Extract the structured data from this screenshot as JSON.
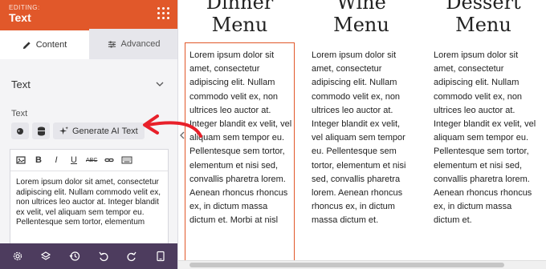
{
  "panel": {
    "editing_label": "EDITING:",
    "title": "Text",
    "tabs": {
      "content": "Content",
      "advanced": "Advanced"
    },
    "section_title": "Text",
    "field_label": "Text",
    "ai_button": "Generate AI Text",
    "editor_text": "Lorem ipsum dolor sit amet, consectetur adipiscing elit. Nullam commodo velit ex, non ultrices leo auctor at. Integer blandit ex velit, vel aliquam sem tempor eu. Pellentesque sem tortor, elementum",
    "toolbar": {
      "bold": "B",
      "italic": "I",
      "underline": "U",
      "strike": "ABC"
    }
  },
  "preview": {
    "columns": [
      {
        "title": "Dinner\nMenu",
        "body": "Lorem ipsum dolor sit amet, consectetur adipiscing elit. Nullam commodo velit ex, non ultrices leo auctor at. Integer blandit ex velit, vel aliquam sem tempor eu. Pellentesque sem tortor, elementum et nisi sed, convallis pharetra lorem. Aenean rhoncus rhoncus ex, in dictum massa dictum et. Morbi at nisl"
      },
      {
        "title": "Wine\nMenu",
        "body": "Lorem ipsum dolor sit amet, consectetur adipiscing elit. Nullam commodo velit ex, non ultrices leo auctor at. Integer blandit ex velit, vel aliquam sem tempor eu. Pellentesque sem tortor, elementum et nisi sed, convallis pharetra lorem. Aenean rhoncus rhoncus ex, in dictum massa dictum et."
      },
      {
        "title": "Dessert\nMenu",
        "body": "Lorem ipsum dolor sit amet, consectetur adipiscing elit. Nullam commodo velit ex, non ultrices leo auctor at. Integer blandit ex velit, vel aliquam sem tempor eu. Pellentesque sem tortor, elementum et nisi sed, convallis pharetra lorem. Aenean rhoncus rhoncus ex, in dictum massa dictum et."
      }
    ]
  },
  "icons": {
    "header": "grid-icon",
    "bottom": [
      "gear-icon",
      "layers-icon",
      "history-icon",
      "undo-icon",
      "redo-icon",
      "device-preview-icon"
    ]
  },
  "colors": {
    "accent": "#e1582a",
    "bottom_bar": "#4d3c5e",
    "arrow": "#e8202a"
  }
}
